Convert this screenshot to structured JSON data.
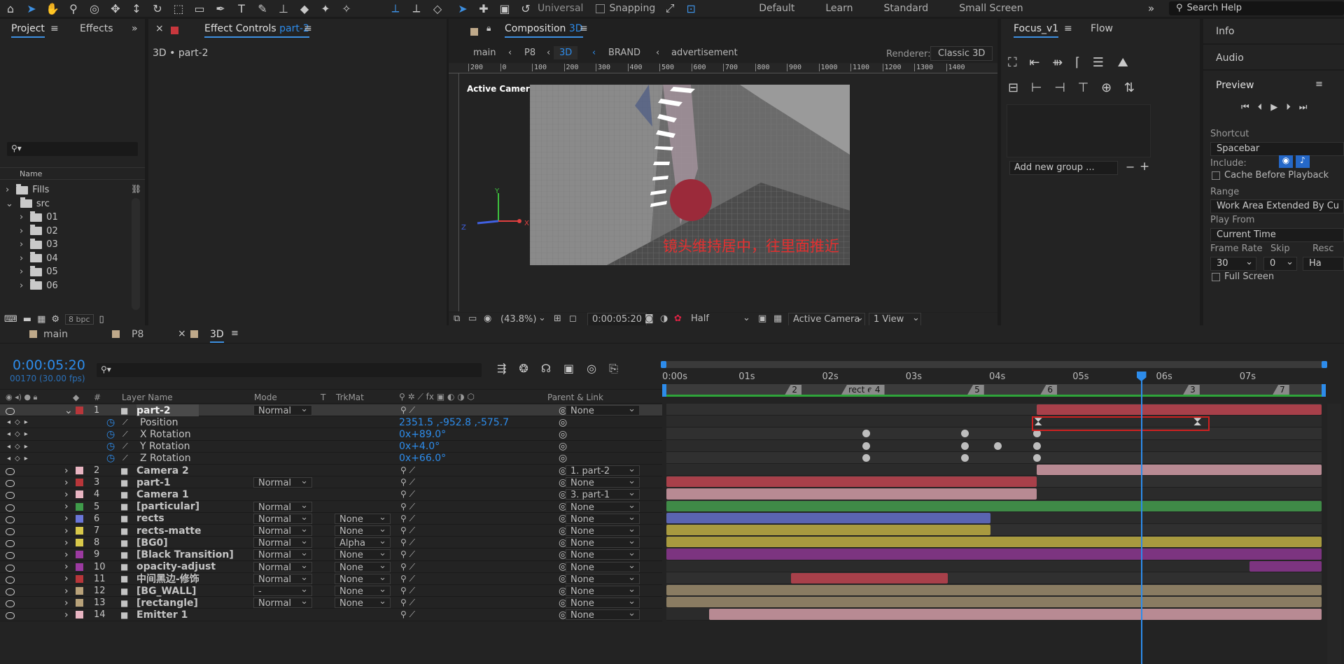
{
  "workspaces": [
    "Default",
    "Learn",
    "Standard",
    "Small Screen"
  ],
  "toolbar": {
    "universal": "Universal",
    "snapping": "Snapping",
    "search_help": "Search Help"
  },
  "project": {
    "tab_project": "Project",
    "tab_effects": "Effects",
    "col_name": "Name",
    "bpc": "8 bpc",
    "tree": [
      {
        "label": "Fills",
        "indent": 0
      },
      {
        "label": "src",
        "indent": 0
      },
      {
        "label": "01",
        "indent": 1
      },
      {
        "label": "02",
        "indent": 1
      },
      {
        "label": "03",
        "indent": 1
      },
      {
        "label": "04",
        "indent": 1
      },
      {
        "label": "05",
        "indent": 1
      },
      {
        "label": "06",
        "indent": 1
      }
    ]
  },
  "effect_controls": {
    "title": "Effect Controls",
    "layer": "part-2",
    "path": "3D • part-2"
  },
  "composition": {
    "title": "Composition",
    "name": "3D",
    "breadcrumbs": [
      "main",
      "P8",
      "3D",
      "BRAND",
      "advertisement"
    ],
    "renderer_label": "Renderer:",
    "renderer_value": "Classic 3D",
    "active_camera_label": "Active Camera",
    "ruler_ticks": [
      "200",
      "0",
      "100",
      "200",
      "300",
      "400",
      "500",
      "600",
      "700",
      "800",
      "900",
      "1000",
      "1100",
      "1200",
      "1300",
      "1400"
    ],
    "axis_y": "Y",
    "axis_x": "X",
    "axis_z": "Z",
    "annotation": "镜头维持居中，往里面推近",
    "zoom": "(43.8%)",
    "timecode": "0:00:05:20",
    "resolution": "Half",
    "view_camera": "Active Camera",
    "views": "1 View"
  },
  "focus": {
    "tab": "Focus_v1",
    "tab_flow": "Flow",
    "add_group_placeholder": "Add new group ..."
  },
  "side": {
    "info": "Info",
    "audio": "Audio",
    "preview": "Preview",
    "shortcut_label": "Shortcut",
    "shortcut_value": "Spacebar",
    "include_label": "Include:",
    "cache_label": "Cache Before Playback",
    "range_label": "Range",
    "range_value": "Work Area Extended By Cu",
    "play_from_label": "Play From",
    "play_from_value": "Current Time",
    "frame_rate_label": "Frame Rate",
    "frame_rate_value": "30",
    "skip_label": "Skip",
    "skip_value": "0",
    "resolution_label": "Resc",
    "resolution_value": "Ha",
    "full_screen_label": "Full Screen"
  },
  "timeline": {
    "tabs": [
      "main",
      "P8",
      "3D"
    ],
    "timecode": "0:00:05:20",
    "frames": "00170 (30.00 fps)",
    "headers": {
      "num": "#",
      "layer_name": "Layer Name",
      "mode": "Mode",
      "t": "T",
      "trkmat": "TrkMat",
      "parent": "Parent & Link"
    },
    "time_labels": [
      "0:00s",
      "01s",
      "02s",
      "03s",
      "04s",
      "05s",
      "06s",
      "07s"
    ],
    "markers": [
      "2",
      "rect e",
      "4",
      "5",
      "6",
      "3",
      "7"
    ],
    "playhead_frac": 0.721,
    "layers": [
      {
        "num": "1",
        "name": "part-2",
        "color": "#b8363a",
        "mode": "Normal",
        "trkmat": "",
        "parent": "None",
        "selected": true
      },
      {
        "num": "2",
        "name": "Camera 2",
        "color": "#e8b5c2",
        "mode": "",
        "trkmat": "",
        "parent": "1. part-2"
      },
      {
        "num": "3",
        "name": "part-1",
        "color": "#b8363a",
        "mode": "Normal",
        "trkmat": "",
        "parent": "None"
      },
      {
        "num": "4",
        "name": "Camera 1",
        "color": "#e8b5c2",
        "mode": "",
        "trkmat": "",
        "parent": "3. part-1"
      },
      {
        "num": "5",
        "name": "[particular]",
        "color": "#3f9b4a",
        "mode": "Normal",
        "trkmat": "",
        "parent": "None"
      },
      {
        "num": "6",
        "name": "rects",
        "color": "#6a76d8",
        "mode": "Normal",
        "trkmat": "None",
        "parent": "None"
      },
      {
        "num": "7",
        "name": "rects-matte",
        "color": "#d8c84a",
        "mode": "Normal",
        "trkmat": "None",
        "parent": "None"
      },
      {
        "num": "8",
        "name": "[BG0]",
        "color": "#d8c84a",
        "mode": "Normal",
        "trkmat": "Alpha",
        "parent": "None"
      },
      {
        "num": "9",
        "name": "[Black Transition]",
        "color": "#9b3aa0",
        "mode": "Normal",
        "trkmat": "None",
        "parent": "None"
      },
      {
        "num": "10",
        "name": "opacity-adjust",
        "color": "#9b3aa0",
        "mode": "Normal",
        "trkmat": "None",
        "parent": "None"
      },
      {
        "num": "11",
        "name": "中间黑边-修饰",
        "color": "#b8363a",
        "mode": "Normal",
        "trkmat": "None",
        "parent": "None"
      },
      {
        "num": "12",
        "name": "[BG_WALL]",
        "color": "#b8a27a",
        "mode": "-",
        "trkmat": "None",
        "parent": "None"
      },
      {
        "num": "13",
        "name": "[rectangle]",
        "color": "#b8a27a",
        "mode": "Normal",
        "trkmat": "None",
        "parent": "None"
      },
      {
        "num": "14",
        "name": "Emitter 1",
        "color": "#e8b5c2",
        "mode": "",
        "trkmat": "",
        "parent": "None"
      }
    ],
    "props": [
      {
        "name": "Position",
        "value": "2351.5 ,-952.8 ,-575.7"
      },
      {
        "name": "X Rotation",
        "value": "0x+89.0°"
      },
      {
        "name": "Y Rotation",
        "value": "0x+4.0°"
      },
      {
        "name": "Z Rotation",
        "value": "0x+66.0°"
      }
    ],
    "bars": [
      {
        "row": 0,
        "start": 0.565,
        "end": 1.0,
        "color": "#a8404a"
      },
      {
        "row": 5,
        "start": 0.565,
        "end": 1.0,
        "color": "#b88a93"
      },
      {
        "row": 6,
        "start": 0.0,
        "end": 0.565,
        "color": "#a8404a"
      },
      {
        "row": 7,
        "start": 0.0,
        "end": 0.565,
        "color": "#b88a93"
      },
      {
        "row": 8,
        "start": 0.0,
        "end": 1.0,
        "color": "#3f8a47"
      },
      {
        "row": 9,
        "start": 0.0,
        "end": 0.495,
        "color": "#5a64b0"
      },
      {
        "row": 10,
        "start": 0.0,
        "end": 0.495,
        "color": "#a89a3f"
      },
      {
        "row": 11,
        "start": 0.0,
        "end": 1.0,
        "color": "#a89a3f"
      },
      {
        "row": 12,
        "start": 0.0,
        "end": 1.0,
        "color": "#7c3480"
      },
      {
        "row": 13,
        "start": 0.89,
        "end": 1.0,
        "color": "#7c3480"
      },
      {
        "row": 14,
        "start": 0.19,
        "end": 0.43,
        "color": "#a8404a"
      },
      {
        "row": 15,
        "start": 0.0,
        "end": 1.0,
        "color": "#8a7c62"
      },
      {
        "row": 16,
        "start": 0.0,
        "end": 1.0,
        "color": "#8a7c62"
      },
      {
        "row": 17,
        "start": 0.065,
        "end": 1.0,
        "color": "#b88a93"
      }
    ]
  }
}
